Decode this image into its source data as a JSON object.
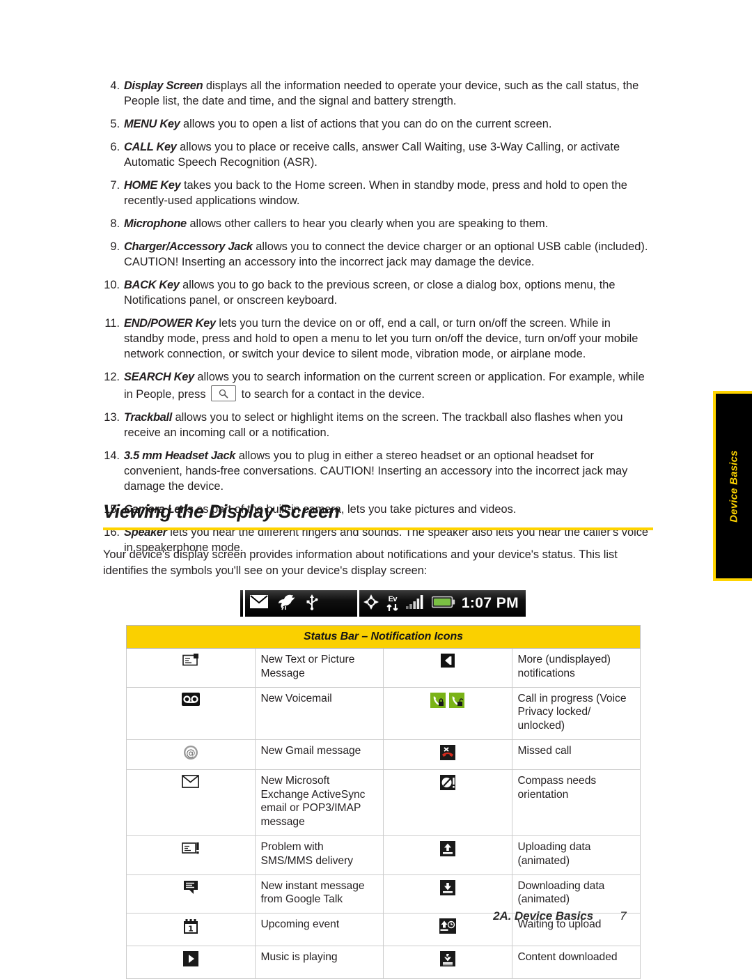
{
  "document": {
    "footer_section": "2A. Device Basics",
    "page_number": "7",
    "side_tab_label": "Device Basics"
  },
  "colors": {
    "accent_yellow": "#ffd400",
    "header_yellow": "#fad000",
    "text": "#231f20",
    "battery_green": "#7ac043"
  },
  "list": {
    "items": [
      {
        "num": "4.",
        "term": "Display Screen",
        "text": " displays all the information needed to operate your device, such as the call status, the People list, the date and time, and the signal and battery strength."
      },
      {
        "num": "5.",
        "term": "MENU Key",
        "text": " allows you to open a list of actions that you can do on the current screen."
      },
      {
        "num": "6.",
        "term": "CALL Key",
        "text": " allows you to place or receive calls, answer Call Waiting, use 3-Way Calling, or activate Automatic Speech Recognition (ASR)."
      },
      {
        "num": "7.",
        "term": "HOME Key",
        "text": " takes you back to the Home screen. When in standby mode, press and hold to open the recently-used applications window."
      },
      {
        "num": "8.",
        "term": "Microphone",
        "text": " allows other callers to hear you clearly when you are speaking to them."
      },
      {
        "num": "9.",
        "term": "Charger/Accessory Jack",
        "text": " allows you to connect the device charger or an optional USB cable (included). CAUTION! Inserting an accessory into the incorrect jack may damage the device."
      },
      {
        "num": "10.",
        "term": "BACK Key",
        "text": " allows you to go back to the previous screen, or close a dialog box, options menu, the Notifications panel, or onscreen keyboard."
      },
      {
        "num": "11.",
        "term": "END/POWER Key",
        "text": " lets you turn the device on or off, end a call, or turn on/off the screen. While in standby mode, press and hold to open a menu to let you turn on/off the device, turn on/off your mobile network connection, or switch your device to silent mode, vibration mode, or airplane mode."
      },
      {
        "num": "12.",
        "term": "SEARCH Key",
        "text": " allows you to search information on the current screen or application. For example, while in People, press ",
        "text_after_key": " to search for a contact in the device.",
        "inline_icon": "search-icon"
      },
      {
        "num": "13.",
        "term": "Trackball",
        "text": " allows you to select or highlight items on the screen. The trackball also flashes when you receive an incoming call or a notification."
      },
      {
        "num": "14.",
        "term": "3.5 mm Headset Jack",
        "text": " allows you to plug in either a stereo headset or an optional headset for convenient, hands-free conversations. CAUTION! Inserting an accessory into the incorrect jack may damage the device."
      },
      {
        "num": "15.",
        "term": "Camera Lens",
        "text": " as part of the built-in camera, lets you take pictures and videos."
      },
      {
        "num": "16.",
        "term": "Speaker",
        "text": " lets you hear the different ringers and sounds. The speaker also lets you hear the caller's voice in speakerphone mode."
      }
    ]
  },
  "section": {
    "heading": "Viewing the Display Screen",
    "intro": "Your device's display screen provides information about notifications and your device's status. This list identifies the symbols you'll see on your device's display screen:"
  },
  "status_bar_graphic": {
    "left_icons": [
      "envelope-icon",
      "bird-icon",
      "usb-icon"
    ],
    "right_icons": [
      "gps-crosshair-icon",
      "ev-data-icon",
      "signal-bars-icon",
      "battery-icon"
    ],
    "ev_label": "Ev",
    "time": "1:07 PM"
  },
  "icon_table": {
    "header": "Status Bar – Notification Icons",
    "rows": [
      {
        "left_icon": "new-message-icon",
        "left_label": "New Text or Picture Message",
        "right_icon": "more-notifications-icon",
        "right_label": "More (undisplayed) notifications"
      },
      {
        "left_icon": "voicemail-icon",
        "left_label": "New Voicemail",
        "right_icon": "call-in-progress-icon",
        "right_label": "Call in progress (Voice Privacy locked/ unlocked)"
      },
      {
        "left_icon": "gmail-icon",
        "left_label": "New Gmail message",
        "right_icon": "missed-call-icon",
        "right_label": "Missed call"
      },
      {
        "left_icon": "exchange-email-icon",
        "left_label": "New Microsoft Exchange ActiveSync email or POP3/IMAP message",
        "right_icon": "compass-orientation-icon",
        "right_label": "Compass needs orientation"
      },
      {
        "left_icon": "sms-problem-icon",
        "left_label": "Problem with SMS/MMS delivery",
        "right_icon": "upload-icon",
        "right_label": "Uploading data (animated)"
      },
      {
        "left_icon": "google-talk-icon",
        "left_label": "New instant message from Google Talk",
        "right_icon": "download-icon",
        "right_label": "Downloading data (animated)"
      },
      {
        "left_icon": "calendar-event-icon",
        "left_label": "Upcoming event",
        "right_icon": "waiting-upload-icon",
        "right_label": "Waiting to upload"
      },
      {
        "left_icon": "music-playing-icon",
        "left_label": "Music is playing",
        "right_icon": "content-downloaded-icon",
        "right_label": "Content downloaded"
      }
    ]
  }
}
